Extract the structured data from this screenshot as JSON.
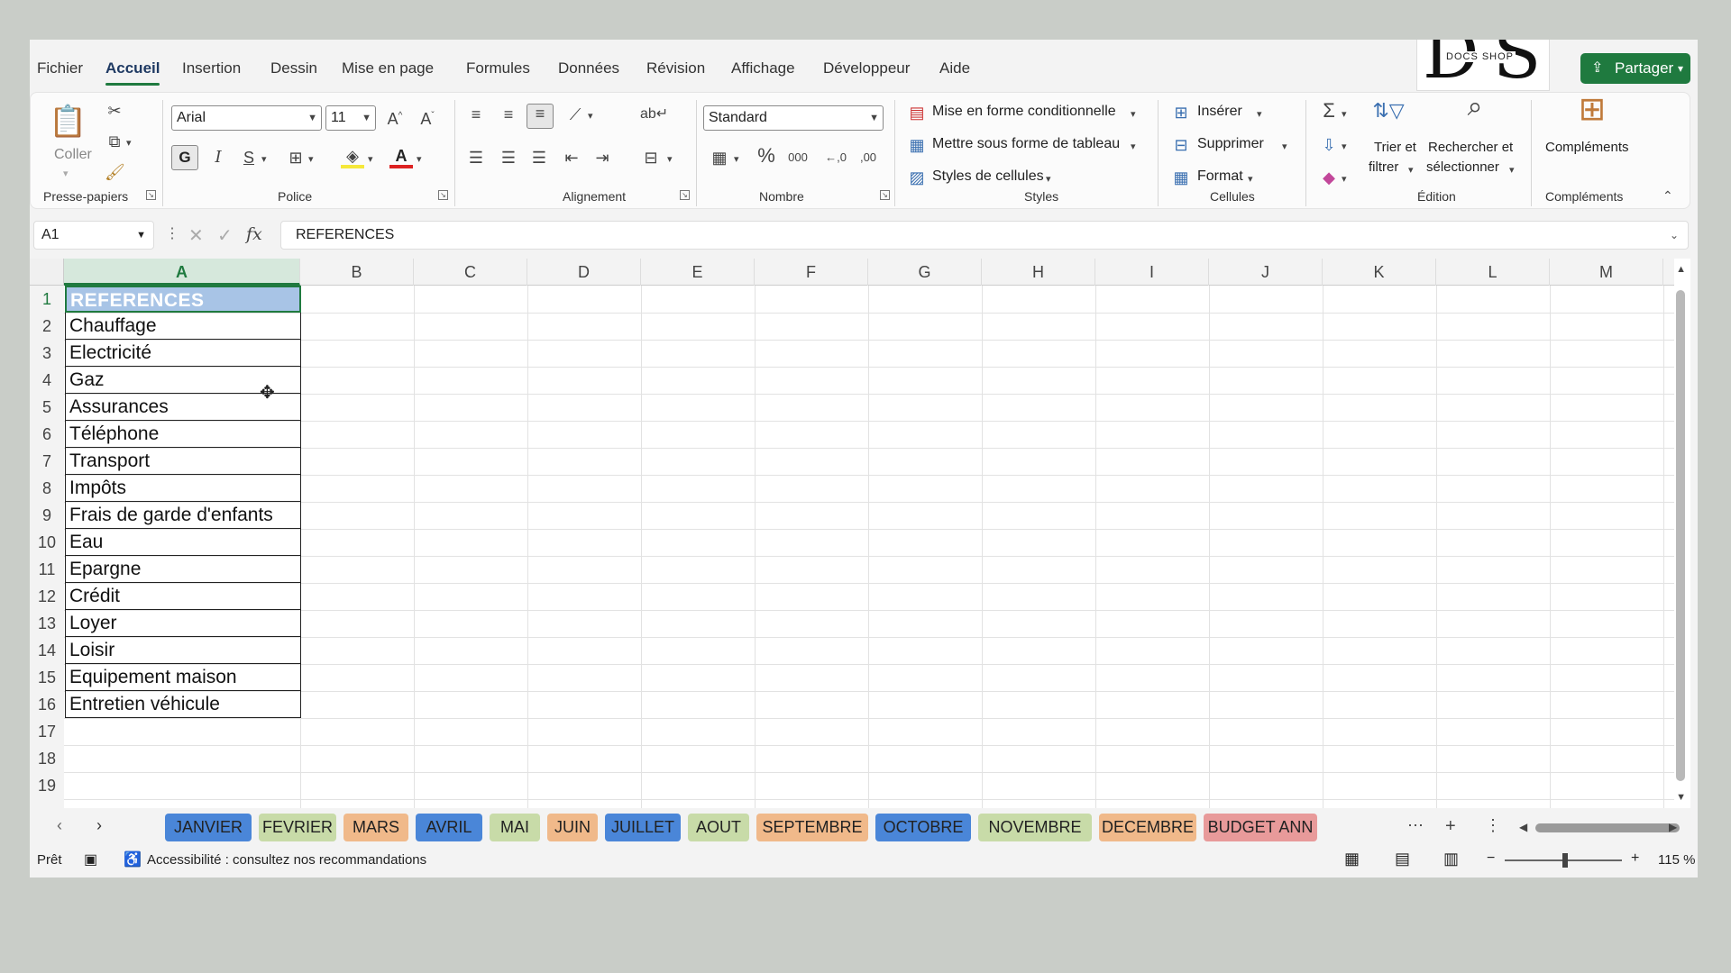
{
  "menu": {
    "items": [
      "Fichier",
      "Accueil",
      "Insertion",
      "Dessin",
      "Mise en page",
      "Formules",
      "Données",
      "Révision",
      "Affichage",
      "Développeur",
      "Aide"
    ],
    "active": "Accueil"
  },
  "logo": {
    "letters_left": "D",
    "letters_right": "S",
    "caption": "DOCS SHOP"
  },
  "share_label": "Partager",
  "ribbon": {
    "clipboard": {
      "paste_label": "Coller",
      "group_label": "Presse-papiers"
    },
    "font": {
      "family": "Arial",
      "size": "11",
      "bold": "G",
      "italic": "I",
      "underline": "S",
      "group_label": "Police"
    },
    "alignment": {
      "group_label": "Alignment",
      "group_label_fr": "Alignement"
    },
    "number": {
      "format": "Standard",
      "group_label": "Nombre",
      "percent": "%",
      "thousands": "000",
      "dec_inc": "←,0",
      "dec_dec": ",00"
    },
    "styles": {
      "conditional": "Mise en forme conditionnelle",
      "as_table": "Mettre sous forme de tableau",
      "cell_styles": "Styles de cellules",
      "group_label": "Styles"
    },
    "cells": {
      "insert": "Insérer",
      "delete": "Supprimer",
      "format": "Format",
      "group_label": "Cellules"
    },
    "editing": {
      "sort_line1": "Trier et",
      "sort_line2": "filtrer",
      "find_line1": "Rechercher et",
      "find_line2": "sélectionner",
      "group_label": "Édition"
    },
    "addins": {
      "label": "Compléments",
      "group_label": "Compléments"
    }
  },
  "formula_bar": {
    "cell_ref": "A1",
    "fx": "fx",
    "content": "REFERENCES"
  },
  "columns": [
    "A",
    "B",
    "C",
    "D",
    "E",
    "F",
    "G",
    "H",
    "I",
    "J",
    "K",
    "L",
    "M"
  ],
  "rows": [
    "1",
    "2",
    "3",
    "4",
    "5",
    "6",
    "7",
    "8",
    "9",
    "10",
    "11",
    "12",
    "13",
    "14",
    "15",
    "16",
    "17",
    "18",
    "19"
  ],
  "cells_a": [
    "REFERENCES",
    "Chauffage",
    "Electricité",
    "Gaz",
    "Assurances",
    "Téléphone",
    "Transport",
    "Impôts",
    "Frais de garde d'enfants",
    "Eau",
    "Epargne",
    "Crédit",
    "Loyer",
    "Loisir",
    "Equipement maison",
    "Entretien véhicule"
  ],
  "sheet_tabs": [
    {
      "label": "JANVIER",
      "color": "#4a86d8"
    },
    {
      "label": "FEVRIER",
      "color": "#c8dba8"
    },
    {
      "label": "MARS",
      "color": "#f0b98a"
    },
    {
      "label": "AVRIL",
      "color": "#4a86d8"
    },
    {
      "label": "MAI",
      "color": "#c8dba8"
    },
    {
      "label": "JUIN",
      "color": "#f0b98a"
    },
    {
      "label": "JUILLET",
      "color": "#4a86d8"
    },
    {
      "label": "AOUT",
      "color": "#c8dba8"
    },
    {
      "label": "SEPTEMBRE",
      "color": "#f0b98a"
    },
    {
      "label": "OCTOBRE",
      "color": "#4a86d8"
    },
    {
      "label": "NOVEMBRE",
      "color": "#c8dba8"
    },
    {
      "label": "DECEMBRE",
      "color": "#f0b98a"
    },
    {
      "label": "BUDGET ANN",
      "color": "#e89a9a"
    }
  ],
  "status": {
    "ready": "Prêt",
    "accessibility": "Accessibilité : consultez nos recommandations",
    "zoom": "115 %"
  },
  "accent": "#1f7a3f"
}
